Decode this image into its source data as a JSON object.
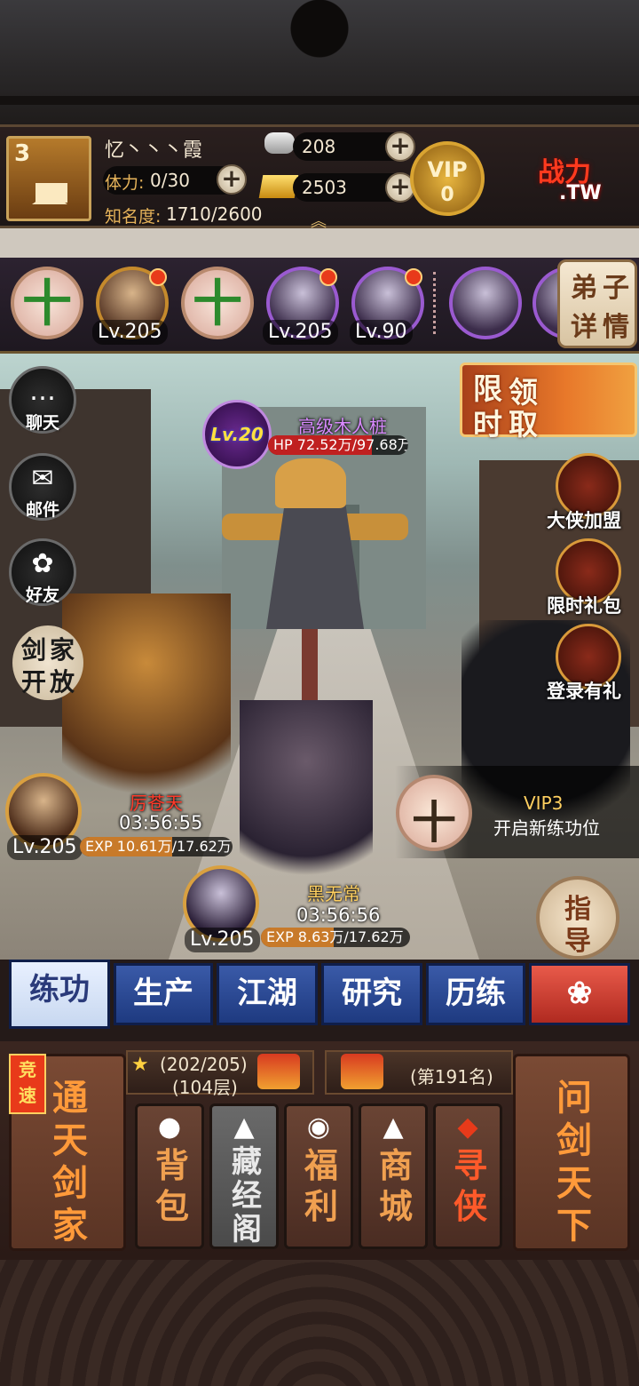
{
  "player": {
    "rank": "3",
    "name": "忆丶丶丶霞",
    "stamina_label": "体力:",
    "stamina_value": "0/30",
    "fame_label": "知名度:",
    "fame_value": "1710/2600",
    "silver": "208",
    "gold": "2503",
    "vip_label": "VIP",
    "vip_level": "0",
    "plus": "+"
  },
  "brand": {
    "line1": "战力",
    "line2": ".TW"
  },
  "hero_row": {
    "add_symbol": "十",
    "levels": [
      "Lv.205",
      "Lv.205",
      "Lv.90"
    ],
    "disciple_button": [
      "弟",
      "子",
      "详",
      "情"
    ]
  },
  "left_menu": [
    {
      "icon": "…",
      "label": "聊天"
    },
    {
      "icon": "✉",
      "label": "邮件"
    },
    {
      "icon": "✿",
      "label": "好友"
    }
  ],
  "sword_open": [
    "剑",
    "家",
    "开",
    "放"
  ],
  "limited_claim": [
    "限",
    "领",
    "时",
    "取"
  ],
  "right_menu": [
    {
      "label": "大侠加盟"
    },
    {
      "label": "限时礼包"
    },
    {
      "label": "登录有礼"
    }
  ],
  "boss": {
    "level": "Lv.20",
    "name": "高级木人桩",
    "hp_text": "HP 72.52万/97.68万",
    "hp_fraction": 0.742
  },
  "trainees": [
    {
      "name": "厉苍天",
      "timer": "03:56:55",
      "level": "Lv.205",
      "exp_text": "EXP 10.61万/17.62万",
      "exp_fraction": 0.602
    },
    {
      "name": "黑无常",
      "timer": "03:56:56",
      "level": "Lv.205",
      "exp_text": "EXP 8.63万/17.62万",
      "exp_fraction": 0.49
    }
  ],
  "vip_slot": {
    "title": "VIP3",
    "desc": "开启新练功位",
    "symbol": "十"
  },
  "guide": [
    "指",
    "导"
  ],
  "tabs": [
    "练功",
    "生产",
    "江湖",
    "研究",
    "历练",
    "❀"
  ],
  "bottom": {
    "race_tag": [
      "竞",
      "速"
    ],
    "left_big": [
      "通",
      "天",
      "剑",
      "家"
    ],
    "progress": "(202/205)",
    "floor": "(104层)",
    "ranking": "(第191名)",
    "right_big": [
      "问",
      "剑",
      "天",
      "下"
    ],
    "buttons": [
      {
        "icon": "●",
        "label": "背包"
      },
      {
        "icon": "▲",
        "label": "藏经阁"
      },
      {
        "icon": "◉",
        "label": "福利"
      },
      {
        "icon": "▲",
        "label": "商城"
      },
      {
        "icon": "◆",
        "label": "寻侠"
      }
    ]
  },
  "colors": {
    "accent_orange": "#ff9a3a",
    "boss_name": "#d98aff",
    "vip_text": "#ffd060",
    "trainee1_name": "#ff3a2a",
    "trainee2_name": "#ffd060"
  }
}
